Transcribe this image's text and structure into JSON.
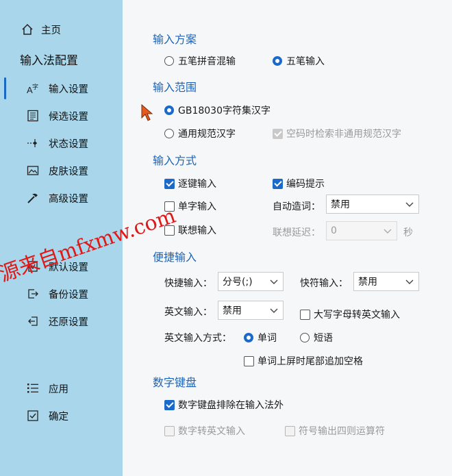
{
  "sidebar": {
    "home": "主页",
    "title": "输入法配置",
    "items": [
      {
        "label": "输入设置",
        "icon": "input-icon"
      },
      {
        "label": "候选设置",
        "icon": "candidate-icon"
      },
      {
        "label": "状态设置",
        "icon": "state-icon"
      },
      {
        "label": "皮肤设置",
        "icon": "skin-icon"
      },
      {
        "label": "高级设置",
        "icon": "advanced-icon"
      },
      {
        "label": "默认设置",
        "icon": "default-icon"
      },
      {
        "label": "备份设置",
        "icon": "backup-icon"
      },
      {
        "label": "还原设置",
        "icon": "restore-icon"
      },
      {
        "label": "应用",
        "icon": "apply-icon"
      },
      {
        "label": "确定",
        "icon": "ok-icon"
      }
    ]
  },
  "scheme": {
    "title": "输入方案",
    "opt1": "五笔拼音混输",
    "opt2": "五笔输入",
    "selected": "五笔输入"
  },
  "range": {
    "title": "输入范围",
    "opt1": "GB18030字符集汉字",
    "opt2": "通用规范汉字",
    "extra": "空码时检索非通用规范汉字",
    "selected": "GB18030字符集汉字"
  },
  "method": {
    "title": "输入方式",
    "zhujian": "逐键输入",
    "bianma": "编码提示",
    "danzi": "单字输入",
    "zidong_label": "自动造词：",
    "zidong_value": "禁用",
    "lianxiang": "联想输入",
    "delay_label": "联想延迟：",
    "delay_value": "0",
    "delay_unit": "秒"
  },
  "quick": {
    "title": "便捷输入",
    "quick_label": "快捷输入：",
    "quick_value": "分号(;)",
    "fast_label": "快符输入：",
    "fast_value": "禁用",
    "en_label": "英文输入：",
    "en_value": "禁用",
    "caps": "大写字母转英文输入",
    "mode_label": "英文输入方式：",
    "mode_word": "单词",
    "mode_phrase": "短语",
    "space": "单词上屏时尾部追加空格"
  },
  "numpad": {
    "title": "数字键盘",
    "exclude": "数字键盘排除在输入法外",
    "toen": "数字转英文输入",
    "calc": "符号输出四则运算符"
  },
  "watermark": "源来自mfxmw.com",
  "colors": {
    "sidebar": "#a9d6ea",
    "accent": "#1b6ac9",
    "section": "#1b64b8",
    "watermark": "#e01818"
  }
}
